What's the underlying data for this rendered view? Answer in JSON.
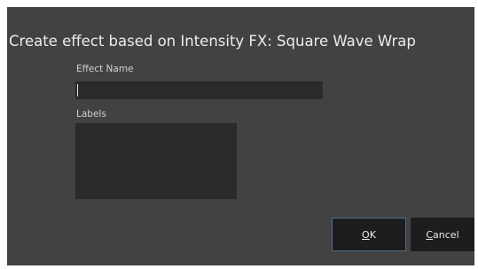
{
  "dialog": {
    "title": "Create effect based on Intensity FX: Square Wave Wrap",
    "effect_name_label": "Effect Name",
    "effect_name_value": "",
    "labels_label": "Labels",
    "labels_value": ""
  },
  "buttons": {
    "ok": {
      "access_key": "O",
      "rest": "K"
    },
    "cancel": {
      "access_key": "C",
      "rest": "ancel"
    }
  }
}
